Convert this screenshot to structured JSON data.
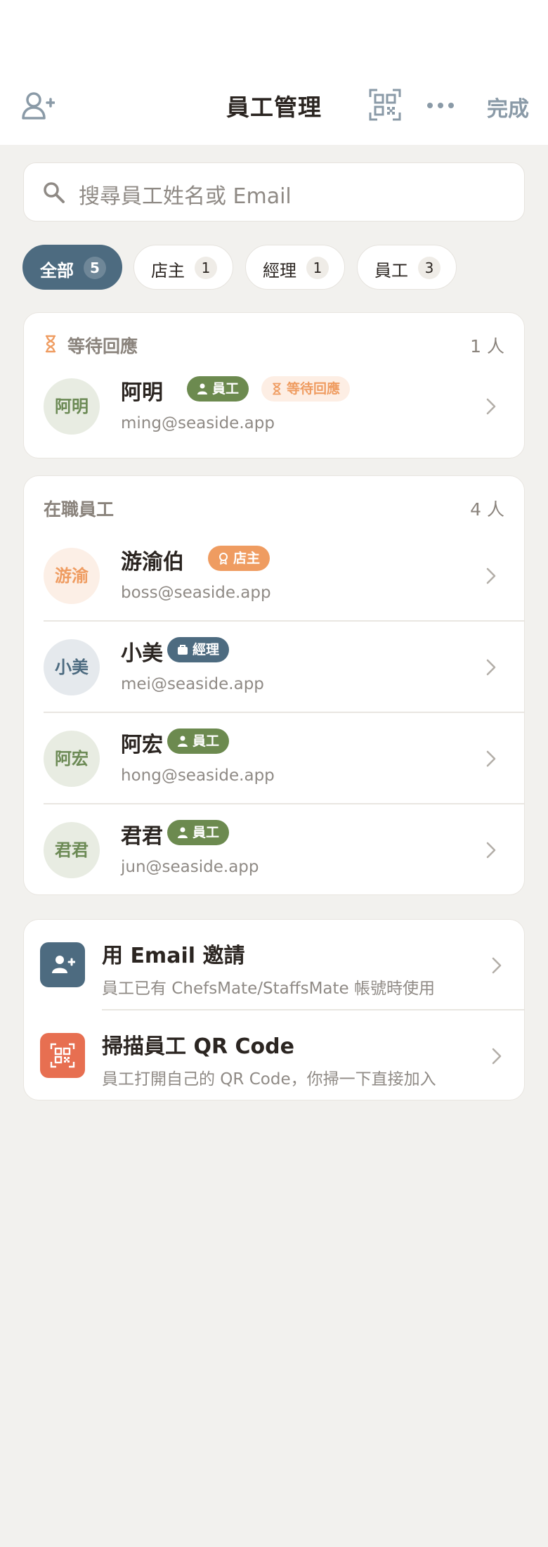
{
  "header": {
    "title": "員工管理",
    "done_label": "完成"
  },
  "search": {
    "placeholder": "搜尋員工姓名或 Email"
  },
  "filters": [
    {
      "label": "全部",
      "count": "5",
      "active": true
    },
    {
      "label": "店主",
      "count": "1",
      "active": false
    },
    {
      "label": "經理",
      "count": "1",
      "active": false
    },
    {
      "label": "員工",
      "count": "3",
      "active": false
    }
  ],
  "pending_section": {
    "title": "等待回應",
    "count": "1 人",
    "members": [
      {
        "avatar": "阿明",
        "name": "阿明",
        "role": "員工",
        "status": "等待回應",
        "email": "ming@seaside.app"
      }
    ]
  },
  "active_section": {
    "title": "在職員工",
    "count": "4 人",
    "members": [
      {
        "avatar": "游渝",
        "name": "游渝伯",
        "role": "店主",
        "email": "boss@seaside.app"
      },
      {
        "avatar": "小美",
        "name": "小美",
        "role": "經理",
        "email": "mei@seaside.app"
      },
      {
        "avatar": "阿宏",
        "name": "阿宏",
        "role": "員工",
        "email": "hong@seaside.app"
      },
      {
        "avatar": "君君",
        "name": "君君",
        "role": "員工",
        "email": "jun@seaside.app"
      }
    ]
  },
  "actions": [
    {
      "title": "用 Email 邀請",
      "subtitle": "員工已有 ChefsMate/StaffsMate 帳號時使用",
      "icon": "add-user-icon"
    },
    {
      "title": "掃描員工 QR Code",
      "subtitle": "員工打開自己的 QR Code，你掃一下直接加入",
      "icon": "qr-scan-icon"
    }
  ],
  "colors": {
    "primary": "#4d6b80",
    "staff_badge": "#6c8a4f",
    "owner_badge": "#ef9c61",
    "pending_badge_bg": "#fdeee4",
    "qr_action": "#e76f51",
    "background": "#f2f1ee"
  }
}
